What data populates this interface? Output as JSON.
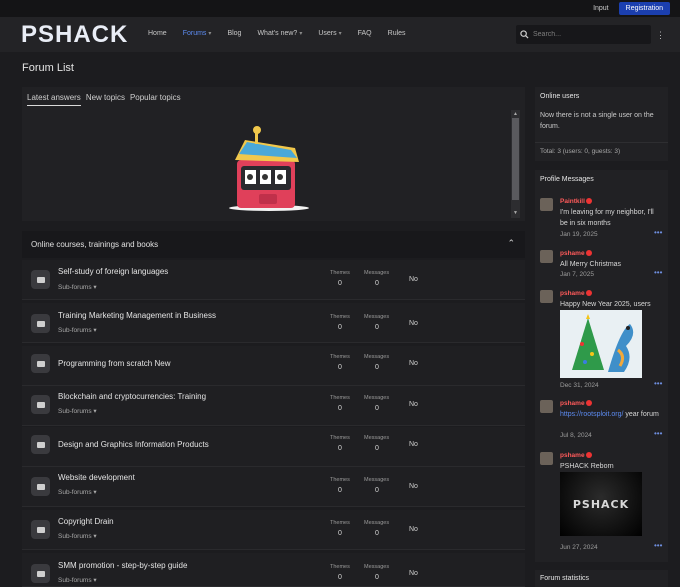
{
  "topbar": {
    "login": "Input",
    "register": "Registration"
  },
  "brand": {
    "logo_a": "PS",
    "logo_b": "HACK"
  },
  "nav": {
    "items": [
      {
        "label": "Home"
      },
      {
        "label": "Forums"
      },
      {
        "label": "Blog"
      },
      {
        "label": "What's new?"
      },
      {
        "label": "Users"
      },
      {
        "label": "FAQ"
      },
      {
        "label": "Rules"
      }
    ],
    "search_placeholder": "Search..."
  },
  "page": {
    "title": "Forum List"
  },
  "tabs": {
    "items": [
      "Latest answers",
      "New topics",
      "Popular topics"
    ]
  },
  "section": {
    "title": "Online courses, trainings and books"
  },
  "forums": {
    "themes_label": "Themes",
    "messages_label": "Messages",
    "subforums_label": "Sub-forums",
    "rows": [
      {
        "title": "Self-study of foreign languages",
        "themes": "0",
        "messages": "0",
        "last": "No"
      },
      {
        "title": "Training Marketing Management in Business",
        "themes": "0",
        "messages": "0",
        "last": "No"
      },
      {
        "title": "Programming from scratch New",
        "themes": "0",
        "messages": "0",
        "last": "No"
      },
      {
        "title": "Blockchain and cryptocurrencies: Training",
        "themes": "0",
        "messages": "0",
        "last": "No"
      },
      {
        "title": "Design and Graphics Information Products",
        "themes": "0",
        "messages": "0",
        "last": "No"
      },
      {
        "title": "Website development",
        "themes": "0",
        "messages": "0",
        "last": "No"
      },
      {
        "title": "Copyright Drain",
        "themes": "0",
        "messages": "0",
        "last": "No"
      },
      {
        "title": "SMM promotion - step-by-step guide",
        "themes": "0",
        "messages": "0",
        "last": "No"
      }
    ]
  },
  "online": {
    "title": "Online users",
    "text": "Now there is not a single user on the forum.",
    "total": "Total: 3 (users: 0, guests: 3)"
  },
  "profile_messages": {
    "title": "Profile Messages",
    "items": [
      {
        "user": "Paintkill",
        "text": "I'm leaving for my neighbor, I'll be in six months",
        "date": "Jan 19, 2025"
      },
      {
        "user": "pshame",
        "text": "All Merry Christmas",
        "date": "Jan 7, 2025"
      },
      {
        "user": "pshame",
        "text": "Happy New Year 2025, users",
        "date": "Dec 31, 2024"
      },
      {
        "user": "pshame",
        "link": "https://rootsploit.org/",
        "text": "year forum",
        "date": "Jul 8, 2024"
      },
      {
        "user": "pshame",
        "text": "PSHACK Reborn",
        "image_text": "PSHACK",
        "date": "Jun 27, 2024"
      }
    ]
  },
  "stats": {
    "title": "Forum statistics"
  },
  "colors": {
    "accent": "#5c8bf0",
    "register": "#1b3faf",
    "username": "#ff5a5a"
  }
}
